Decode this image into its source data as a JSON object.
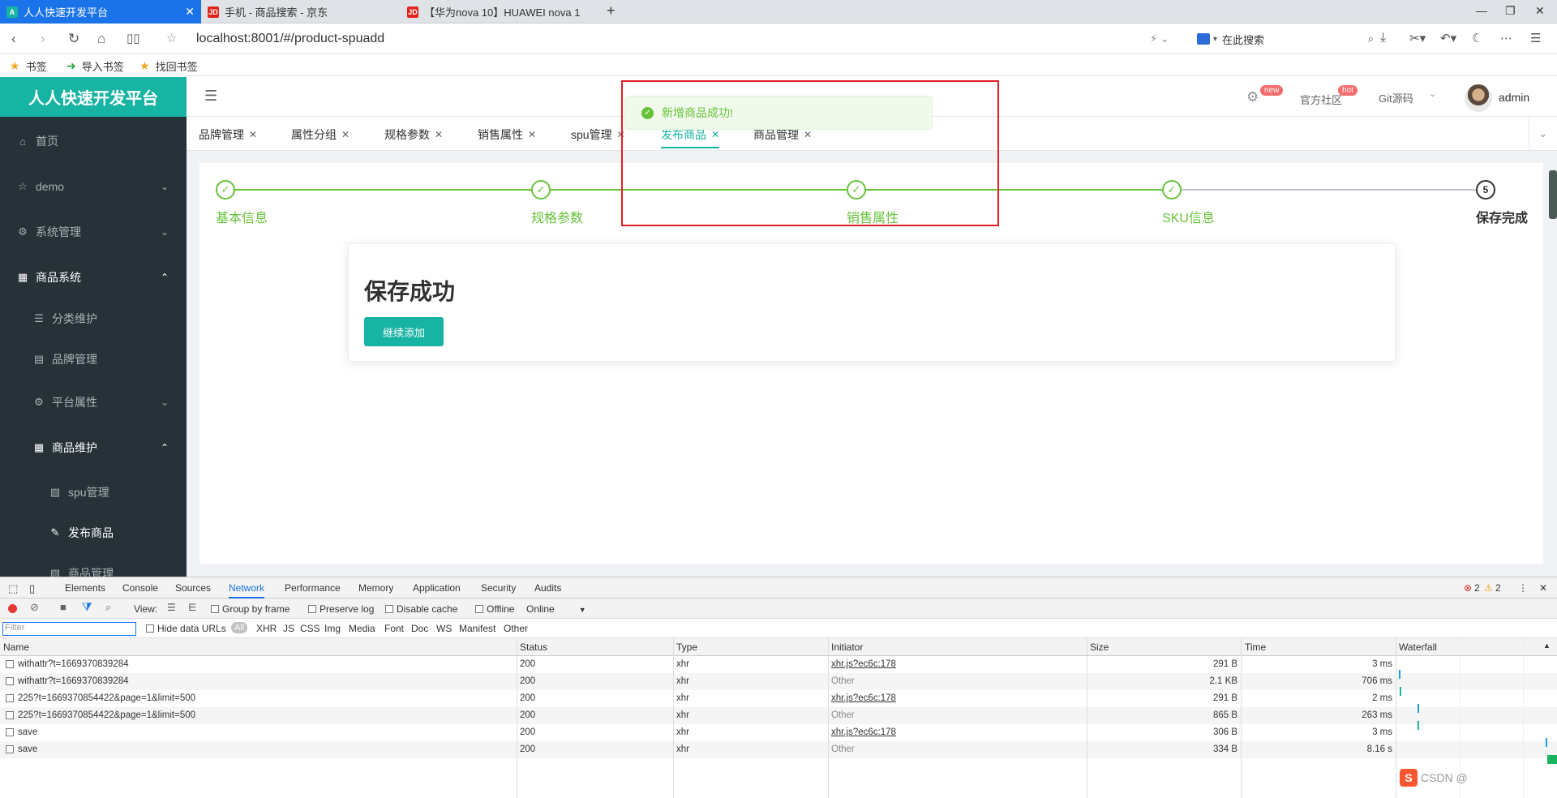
{
  "browser": {
    "tabs": [
      {
        "label": "人人快速开发平台",
        "icon": "A",
        "active": true
      },
      {
        "label": "手机 - 商品搜索 - 京东",
        "icon": "JD"
      },
      {
        "label": "【华为nova 10】HUAWEI nova 1",
        "icon": "JD"
      }
    ],
    "url": "localhost:8001/#/product-spuadd",
    "search_placeholder": "在此搜索",
    "bookmarks": [
      "书签",
      "导入书签",
      "找回书签"
    ]
  },
  "app": {
    "logo": "人人快速开发平台",
    "sidebar": [
      {
        "label": "首页",
        "icon": "home-icon"
      },
      {
        "label": "demo",
        "icon": "star-icon",
        "chevron": "down"
      },
      {
        "label": "系统管理",
        "icon": "gear-icon",
        "chevron": "down"
      },
      {
        "label": "商品系统",
        "icon": "grid-icon",
        "chevron": "up"
      },
      {
        "label": "分类维护",
        "icon": "list-icon"
      },
      {
        "label": "品牌管理",
        "icon": "table-icon"
      },
      {
        "label": "平台属性",
        "icon": "gear-icon",
        "chevron": "down"
      },
      {
        "label": "商品维护",
        "icon": "grid-icon",
        "chevron": "up"
      },
      {
        "label": "spu管理",
        "icon": "file-icon"
      },
      {
        "label": "发布商品",
        "icon": "edit-icon"
      },
      {
        "label": "商品管理",
        "icon": "file-icon"
      }
    ],
    "header": {
      "badge_new": "new",
      "community": "官方社区",
      "badge_hot": "hot",
      "git": "Git源码",
      "user": "admin"
    },
    "tabs": [
      "品牌管理",
      "属性分组",
      "规格参数",
      "销售属性",
      "spu管理",
      "发布商品",
      "商品管理"
    ],
    "active_tab": "发布商品",
    "toast": "新增商品成功!",
    "steps": [
      "基本信息",
      "规格参数",
      "销售属性",
      "SKU信息",
      "保存完成"
    ],
    "final_step_number": "5",
    "result_title": "保存成功",
    "continue_button": "继续添加",
    "colors": {
      "brand": "#17b3a3",
      "success": "#67c23a",
      "sidebar": "#263238",
      "highlight": "#e01e24"
    }
  },
  "devtools": {
    "tabs": [
      "Elements",
      "Console",
      "Sources",
      "Network",
      "Performance",
      "Memory",
      "Application",
      "Security",
      "Audits"
    ],
    "active_tab": "Network",
    "errors": "2",
    "warnings": "2",
    "toolbar": {
      "view": "View:",
      "group_by_frame": "Group by frame",
      "preserve_log": "Preserve log",
      "disable_cache": "Disable cache",
      "offline": "Offline",
      "online": "Online"
    },
    "filter_placeholder": "Filter",
    "hide_data_urls": "Hide data URLs",
    "filters": [
      "All",
      "XHR",
      "JS",
      "CSS",
      "Img",
      "Media",
      "Font",
      "Doc",
      "WS",
      "Manifest",
      "Other"
    ],
    "columns": [
      "Name",
      "Status",
      "Type",
      "Initiator",
      "Size",
      "Time",
      "Waterfall"
    ],
    "rows": [
      {
        "name": "withattr?t=1669370839284",
        "status": "200",
        "type": "xhr",
        "initiator": "xhr.js?ec6c:178",
        "size": "291 B",
        "time": "3 ms"
      },
      {
        "name": "withattr?t=1669370839284",
        "status": "200",
        "type": "xhr",
        "initiator": "Other",
        "size": "2.1 KB",
        "time": "706 ms"
      },
      {
        "name": "225?t=1669370854422&page=1&limit=500",
        "status": "200",
        "type": "xhr",
        "initiator": "xhr.js?ec6c:178",
        "size": "291 B",
        "time": "2 ms"
      },
      {
        "name": "225?t=1669370854422&page=1&limit=500",
        "status": "200",
        "type": "xhr",
        "initiator": "Other",
        "size": "865 B",
        "time": "263 ms"
      },
      {
        "name": "save",
        "status": "200",
        "type": "xhr",
        "initiator": "xhr.js?ec6c:178",
        "size": "306 B",
        "time": "3 ms"
      },
      {
        "name": "save",
        "status": "200",
        "type": "xhr",
        "initiator": "Other",
        "size": "334 B",
        "time": "8.16 s"
      }
    ],
    "watermark": "CSDN @"
  }
}
